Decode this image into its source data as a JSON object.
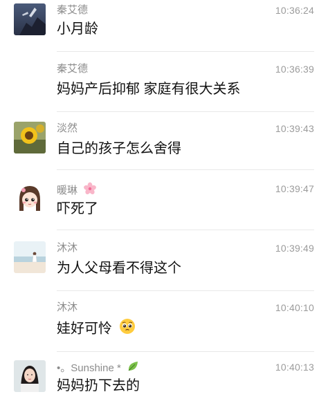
{
  "messages": [
    {
      "name": "秦艾德",
      "time": "10:36:24",
      "text": "小月龄",
      "avatar": "silhouette-photo"
    },
    {
      "name": "秦艾德",
      "time": "10:36:39",
      "text": "妈妈产后抑郁 家庭有很大关系",
      "avatar": ""
    },
    {
      "name": "淡然",
      "time": "10:39:43",
      "text": "自己的孩子怎么舍得",
      "avatar": "sunflower-photo"
    },
    {
      "name": "暖琳",
      "time": "10:39:47",
      "text": "吓死了",
      "avatar": "cartoon-girl",
      "name_emoji": "cherry-blossom-icon"
    },
    {
      "name": "沐沐",
      "time": "10:39:49",
      "text": "为人父母看不得这个",
      "avatar": "beach-photo"
    },
    {
      "name": "沐沐",
      "time": "10:40:10",
      "text": "娃好可怜",
      "avatar": "",
      "text_emoji": "pleading-face-icon"
    },
    {
      "name": "•。Sunshine *",
      "time": "10:40:13",
      "text": "妈妈扔下去的",
      "avatar": "woman-photo",
      "name_emoji": "leaf-icon"
    }
  ]
}
